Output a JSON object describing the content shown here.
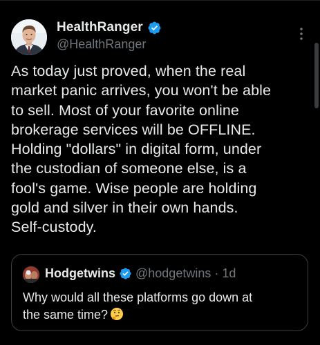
{
  "post": {
    "author": {
      "display_name": "HealthRanger",
      "handle": "@HealthRanger",
      "avatar_icon": "user-avatar-photo",
      "verified_icon": "verified-badge-icon",
      "verified_color": "#1d9bf0"
    },
    "text": "As today just proved, when the real\nmarket panic arrives, you won't be able\nto sell. Most of your favorite online\nbrokerage services will be OFFLINE.\nHolding \"dollars\" in digital form, under\nthe custodian of someone else, is a\nfool's game. Wise people are holding\ngold and silver in their own hands.\nSelf-custody.",
    "more_icon": "more-vertical-icon"
  },
  "quoted_post": {
    "author": {
      "display_name": "Hodgetwins",
      "handle": "@hodgetwins",
      "separator": "·",
      "time": "1d",
      "avatar_icon": "user-avatar-photo",
      "verified_icon": "verified-badge-icon"
    },
    "text": "Why would all these platforms go down at\nthe same time?",
    "emoji": "thinking-face-emoji"
  },
  "colors": {
    "background": "#000000",
    "primary_text": "#e7e9ea",
    "secondary_text": "#71767b",
    "border": "#3a3f44",
    "accent": "#1d9bf0"
  }
}
